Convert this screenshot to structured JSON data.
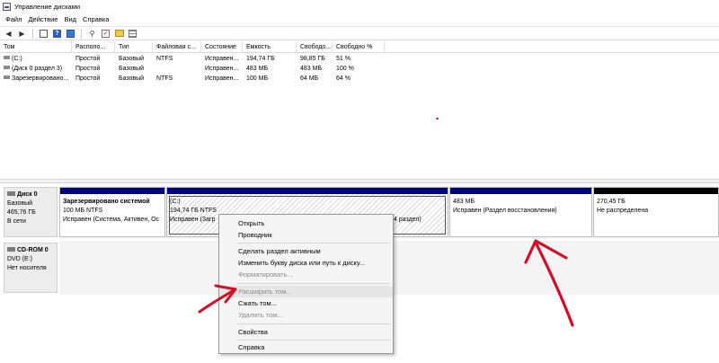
{
  "window": {
    "title": "Управление дисками"
  },
  "menu": [
    "Файл",
    "Действие",
    "Вид",
    "Справка"
  ],
  "toolbar_icons": [
    "back-arrow-icon",
    "forward-arrow-icon",
    "console-tree-icon",
    "help-icon",
    "console-icon",
    "properties-icon",
    "check-icon",
    "folder-icon",
    "grid-icon"
  ],
  "volume_table": {
    "columns": [
      "Том",
      "Располо...",
      "Тип",
      "Файловая с...",
      "Состояние",
      "Емкость",
      "Свободо...",
      "Свободно %"
    ],
    "rows": [
      [
        "(C:)",
        "Простой",
        "Базовый",
        "NTFS",
        "Исправен...",
        "194,74 ГБ",
        "98,85 ГБ",
        "51 %"
      ],
      [
        "(Диск 0 раздел 3)",
        "Простой",
        "Базовый",
        "",
        "Исправен...",
        "483 МБ",
        "483 МБ",
        "100 %"
      ],
      [
        "Зарезервировано...",
        "Простой",
        "Базовый",
        "NTFS",
        "Исправен...",
        "100 МБ",
        "64 МБ",
        "64 %"
      ]
    ]
  },
  "disks": [
    {
      "name": "Диск 0",
      "type": "Базовый",
      "size": "465,76 ГБ",
      "status": "В сети",
      "partitions": [
        {
          "title": "Зарезервировано системой",
          "size": "100 МБ NTFS",
          "status": "Исправен (Система, Активен, Ос"
        },
        {
          "title": "(C:)",
          "size": "194,74 ГБ NTFS",
          "status": "Исправен (Загр",
          "status_tail": "4 раздел)"
        },
        {
          "title": "",
          "size": "483 МБ",
          "status": "Исправен (Раздел восстановления)"
        },
        {
          "title": "",
          "size": "270,45 ГБ",
          "status": "Не распределена"
        }
      ]
    },
    {
      "name": "CD-ROM 0",
      "type": "DVD (E:)",
      "size": "",
      "status": "Нет носителя"
    }
  ],
  "context_menu": {
    "items": [
      {
        "label": "Открыть",
        "enabled": true
      },
      {
        "label": "Проводник",
        "enabled": true
      },
      {
        "label": "Сделать раздел активным",
        "enabled": true
      },
      {
        "label": "Изменить букву диска или путь к диску...",
        "enabled": true
      },
      {
        "label": "Форматировать...",
        "enabled": false
      },
      {
        "label": "Расширить том...",
        "enabled": false,
        "highlighted": true
      },
      {
        "label": "Сжать том...",
        "enabled": true
      },
      {
        "label": "Удалить том...",
        "enabled": false
      },
      {
        "label": "Свойства",
        "enabled": true
      },
      {
        "label": "Справка",
        "enabled": true
      }
    ]
  },
  "colors": {
    "primary_partition_bar": "#00007a",
    "unallocated_bar": "#000000",
    "annotation_red": "#d0102a"
  }
}
